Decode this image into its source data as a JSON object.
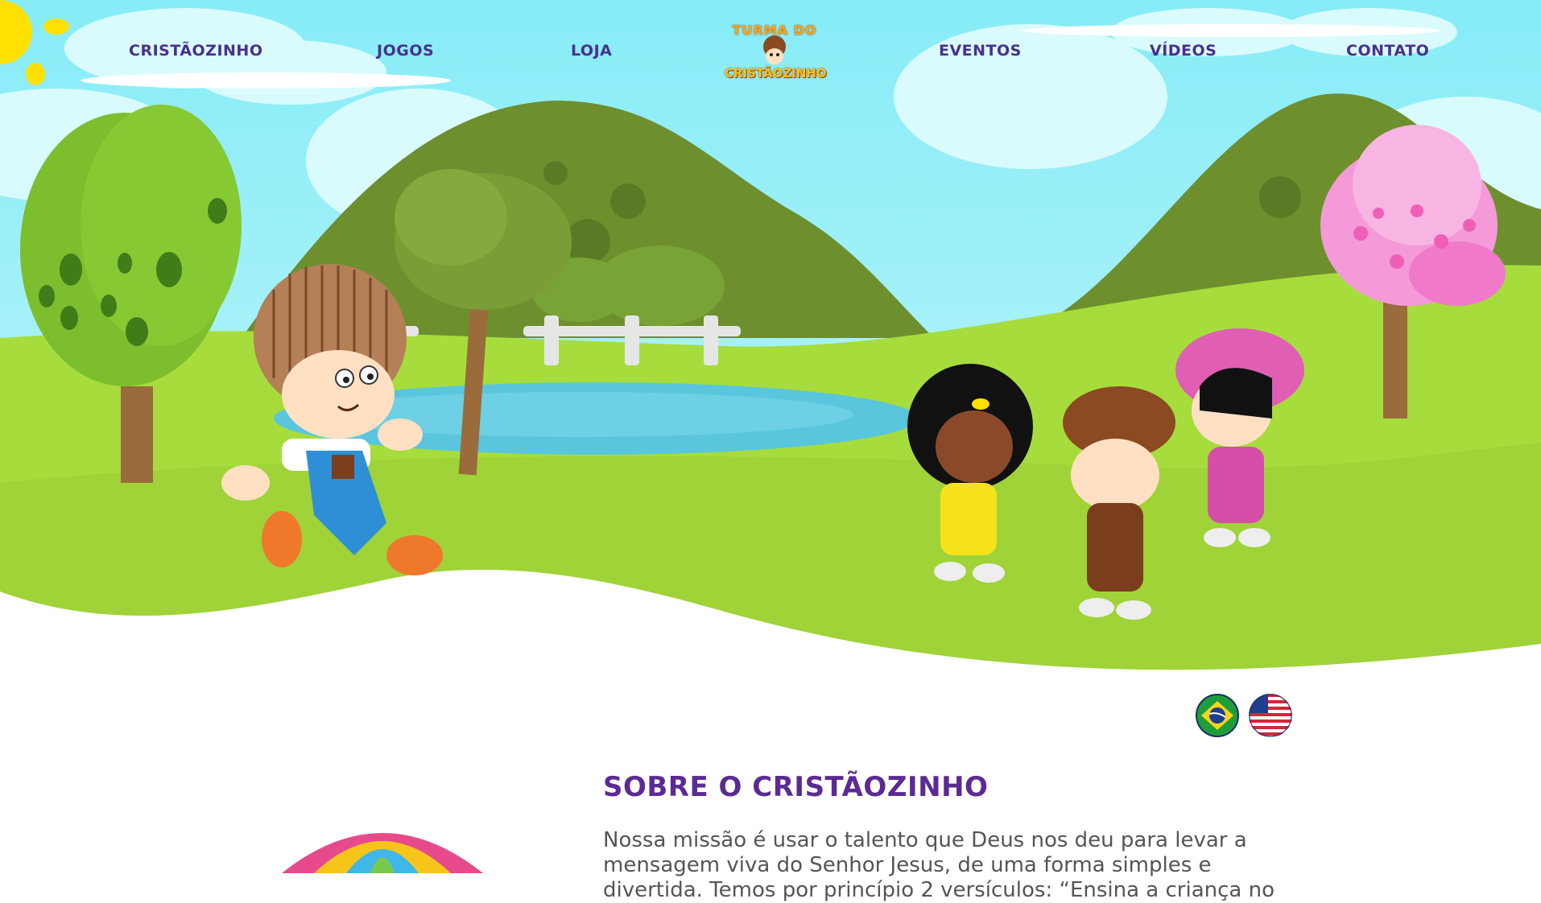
{
  "nav": {
    "left": [
      "CRISTÃOZINHO",
      "JOGOS",
      "LOJA"
    ],
    "right": [
      "EVENTOS",
      "VÍDEOS",
      "CONTATO"
    ]
  },
  "logo": {
    "line1": "TURMA DO",
    "line2": "CRISTÃOZINHO"
  },
  "languages": [
    "Português (Brasil)",
    "English (US)"
  ],
  "about": {
    "title": "SOBRE O CRISTÃOZINHO",
    "text": "Nossa missão é usar o talento que Deus nos deu para levar a mensagem viva do Senhor Jesus, de uma forma simples e divertida. Temos por princípio 2 versículos: “Ensina a criança no"
  },
  "colors": {
    "sky": "#8ff0f6",
    "grass": "#a6dd3c",
    "hill": "#6e8f2e",
    "nav_text": "#4a2f8f",
    "title": "#5b2a94",
    "body_text": "#555555"
  }
}
